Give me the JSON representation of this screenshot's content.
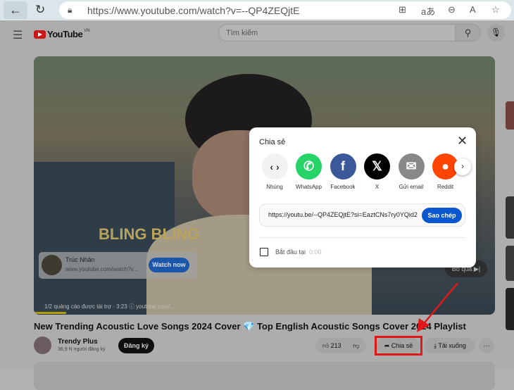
{
  "browser": {
    "url": "https://www.youtube.com/watch?v=--QP4ZEQjtE"
  },
  "header": {
    "logo": "YouTube",
    "region": "VN",
    "search_placeholder": "Tìm kiếm"
  },
  "video": {
    "overlay_text": "BLING BLING",
    "ad": {
      "channel": "Trúc Nhân",
      "url": "www.youtube.com/watch?v...",
      "cta": "Watch now",
      "info": "1/2 quảng cáo được tài trợ · 3:23 ⓘ youtube.com/..."
    },
    "skip_label": "Bỏ qua ▶|",
    "ad_progress_percent": 7
  },
  "title": "New Trending Acoustic Love Songs 2024 Cover 💎 Top English Acoustic Songs Cover 2024 Playlist",
  "channel": {
    "name": "Trendy Plus",
    "subscribers": "36,9 N người đăng ký",
    "subscribe_label": "Đăng ký"
  },
  "actions": {
    "likes": "213",
    "share": "Chia sẻ",
    "download": "Tải xuống",
    "more": "⋯"
  },
  "share_dialog": {
    "title": "Chia sẻ",
    "targets": [
      {
        "label": "Nhúng",
        "glyph": "‹ ›",
        "color": "#f2f2f2"
      },
      {
        "label": "WhatsApp",
        "glyph": "✆",
        "color": "#25d366"
      },
      {
        "label": "Facebook",
        "glyph": "f",
        "color": "#3b5998"
      },
      {
        "label": "X",
        "glyph": "𝕏",
        "color": "#000000"
      },
      {
        "label": "Gửi email",
        "glyph": "✉",
        "color": "#888888"
      },
      {
        "label": "Reddit",
        "glyph": "●",
        "color": "#ff4500"
      }
    ],
    "link": "https://youtu.be/--QP4ZEQjtE?si=EaztCNs7ry0YQid2",
    "copy_label": "Sao chép",
    "start_at_label": "Bắt đầu tại",
    "start_at_time": "0:00",
    "start_at_checked": false
  },
  "annotation_color": "#e01818"
}
